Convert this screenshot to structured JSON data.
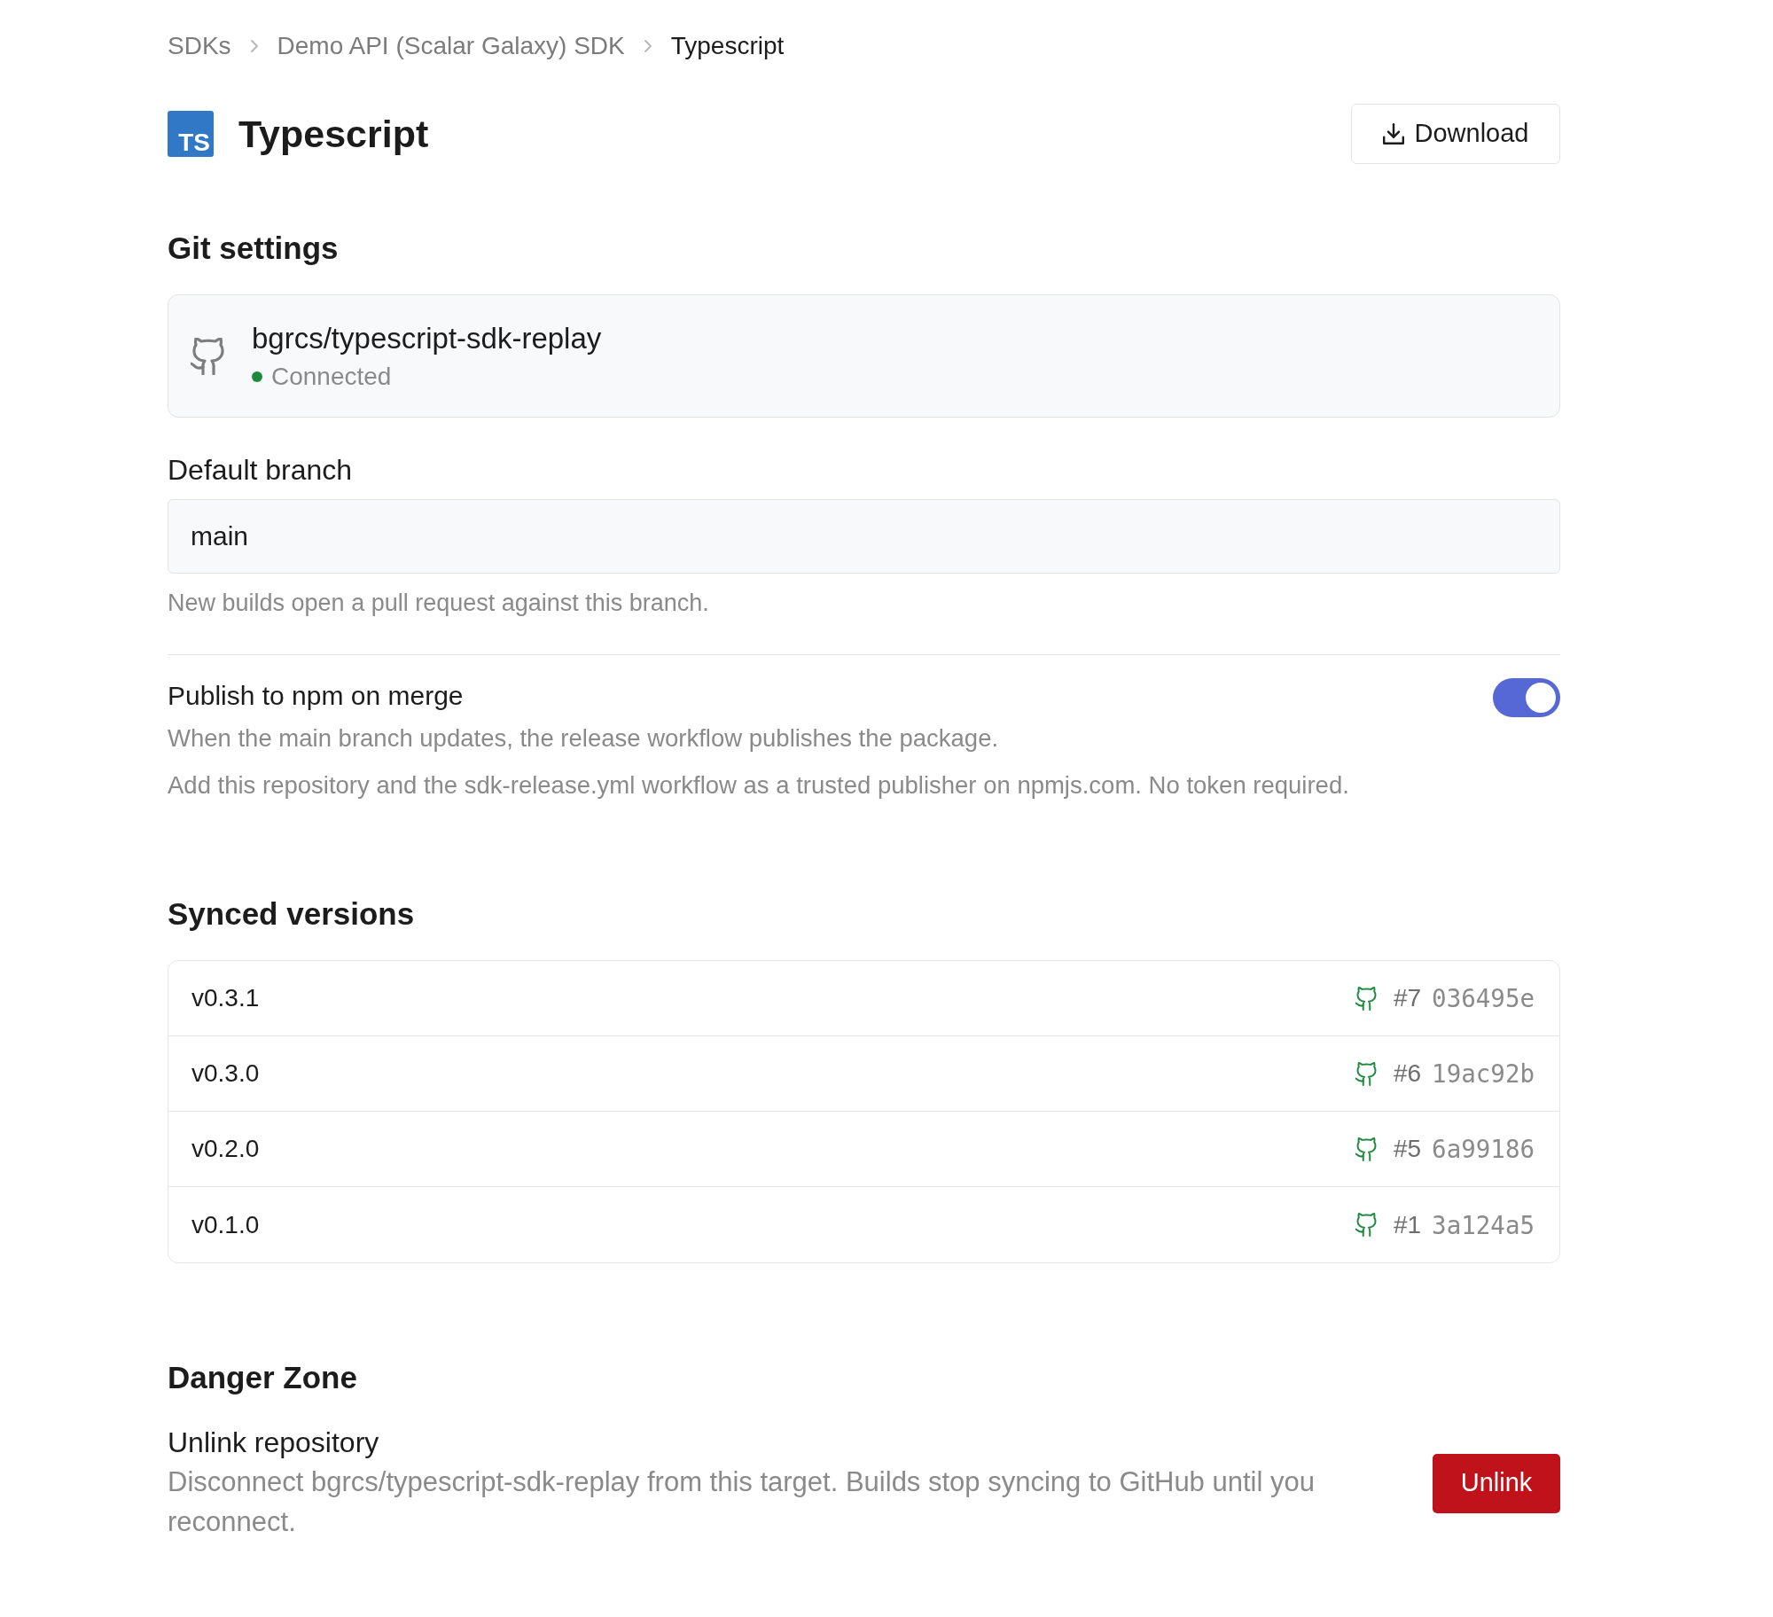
{
  "breadcrumb": [
    {
      "label": "SDKs",
      "current": false
    },
    {
      "label": "Demo API (Scalar Galaxy) SDK",
      "current": false
    },
    {
      "label": "Typescript",
      "current": true
    }
  ],
  "header": {
    "logo": "TS",
    "title": "Typescript",
    "download_button": "Download"
  },
  "git_settings": {
    "heading": "Git settings",
    "repository": {
      "name": "bgrcs/typescript-sdk-replay",
      "status": "Connected",
      "connected": true
    }
  },
  "default_branch": {
    "label": "Default branch",
    "value": "main",
    "hint": "New builds open a pull request against this branch."
  },
  "publish": {
    "label": "Publish to npm on merge",
    "on": true,
    "description": "When the main branch updates, the release workflow publishes the package.",
    "note": "Add this repository and the sdk-release.yml workflow as a trusted publisher on npmjs.com. No token required."
  },
  "synced_versions": {
    "heading": "Synced versions",
    "rows": [
      {
        "version": "v0.3.1",
        "pull_request": "#7",
        "commit": "036495e"
      },
      {
        "version": "v0.3.0",
        "pull_request": "#6",
        "commit": "19ac92b"
      },
      {
        "version": "v0.2.0",
        "pull_request": "#5",
        "commit": "6a99186"
      },
      {
        "version": "v0.1.0",
        "pull_request": "#1",
        "commit": "3a124a5"
      }
    ]
  },
  "danger_zone": {
    "heading": "Danger Zone",
    "title": "Unlink repository",
    "description": "Disconnect bgrcs/typescript-sdk-replay from this target. Builds stop syncing to GitHub until you reconnect.",
    "button": "Unlink"
  }
}
